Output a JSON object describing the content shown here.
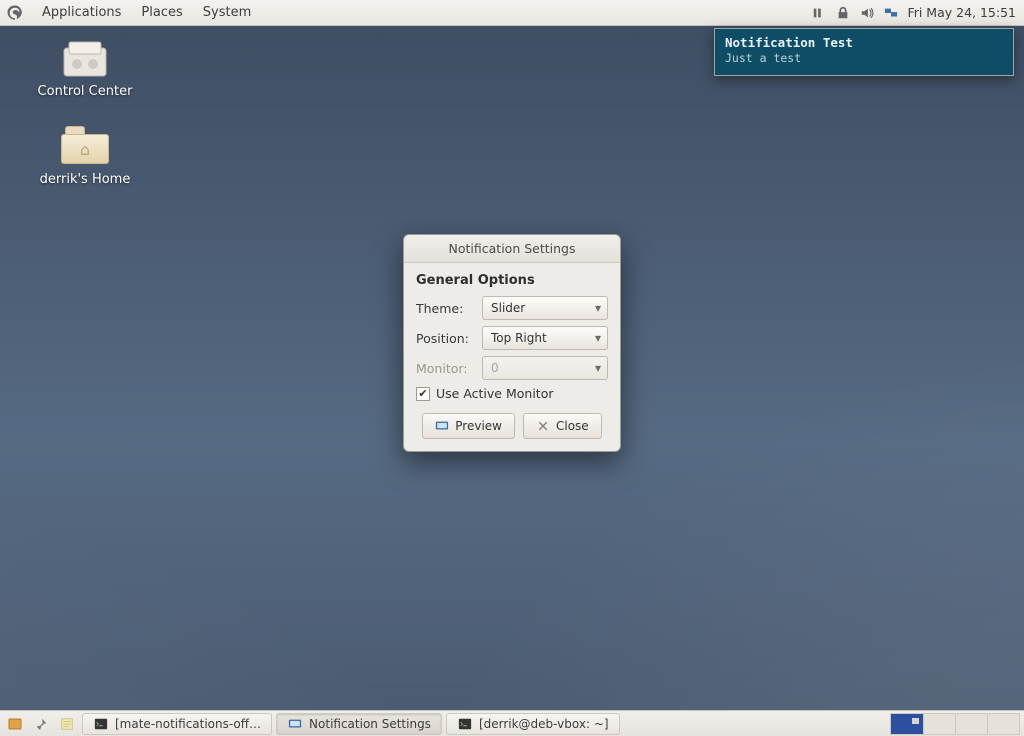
{
  "top_panel": {
    "menus": {
      "apps": "Applications",
      "places": "Places",
      "system": "System"
    },
    "clock": "Fri May 24, 15:51"
  },
  "desktop_icons": {
    "control_center": "Control Center",
    "home_folder": "derrik's Home"
  },
  "notification": {
    "title": "Notification Test",
    "body": "Just a test"
  },
  "dialog": {
    "title": "Notification Settings",
    "section": "General Options",
    "theme_label": "Theme:",
    "theme_value": "Slider",
    "position_label": "Position:",
    "position_value": "Top Right",
    "monitor_label": "Monitor:",
    "monitor_value": "0",
    "use_active_monitor": "Use Active Monitor",
    "preview": "Preview",
    "close": "Close"
  },
  "bottom_panel": {
    "tasks": {
      "t1": "[mate-notifications-off…",
      "t2": "Notification Settings",
      "t3": "[derrik@deb-vbox: ~]"
    }
  }
}
